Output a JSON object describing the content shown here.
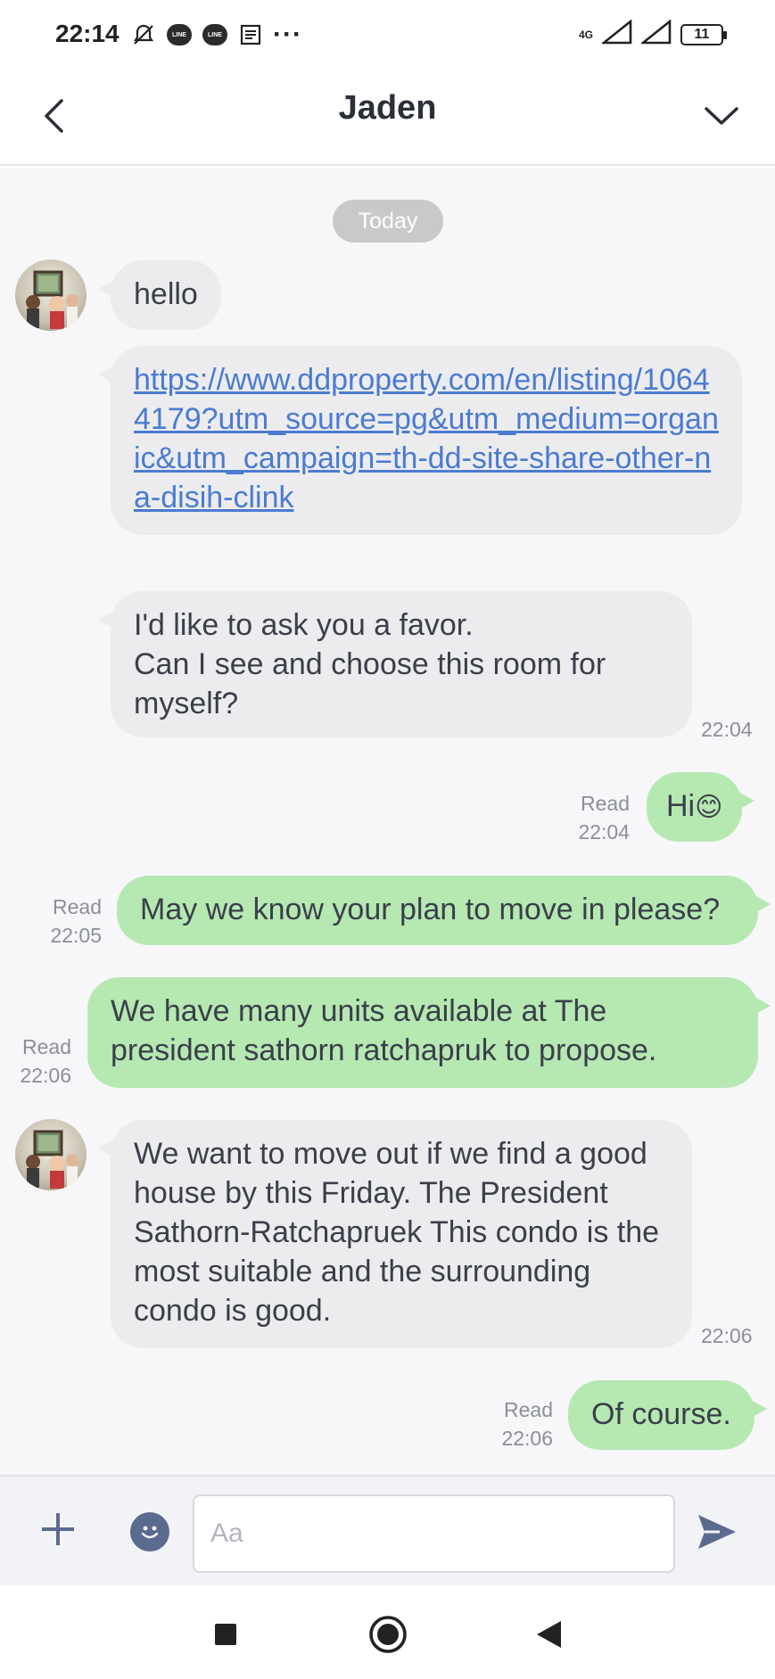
{
  "status_bar": {
    "time": "22:14",
    "network": "4G",
    "battery": "11",
    "more": "···"
  },
  "header": {
    "title": "Jaden"
  },
  "chat": {
    "date_chip": "Today",
    "messages": [
      {
        "side": "in",
        "text": "hello"
      },
      {
        "side": "in",
        "text": "https://www.ddproperty.com/en/listing/10644179?utm_source=pg&utm_medium=organic&utm_campaign=th-dd-site-share-other-na-disih-clink",
        "is_link": true
      },
      {
        "side": "in",
        "line1": "I'd like to ask you a favor.",
        "line2": "Can I see and choose this room for myself?",
        "time": "22:04"
      },
      {
        "side": "out",
        "text": "Hi",
        "emoji": "😊",
        "status": "Read",
        "time": "22:04"
      },
      {
        "side": "out",
        "text": "May we know your plan to move in please?",
        "status": "Read",
        "time": "22:05"
      },
      {
        "side": "out",
        "text": "We have many units available at The president sathorn ratchapruk to propose.",
        "status": "Read",
        "time": "22:06"
      },
      {
        "side": "in",
        "text": "We want to move out if we find a good house by this Friday. The President Sathorn-Ratchapruek This condo is the most suitable and the surrounding condo is good.",
        "time": "22:06"
      },
      {
        "side": "out",
        "text": "Of course.",
        "status": "Read",
        "time": "22:06"
      }
    ]
  },
  "composer": {
    "placeholder": "Aa"
  },
  "colors": {
    "incoming_bubble": "#ececef",
    "outgoing_bubble": "#b6e8b2",
    "link": "#4b7bd1",
    "chat_background": "#f7f7f9"
  }
}
